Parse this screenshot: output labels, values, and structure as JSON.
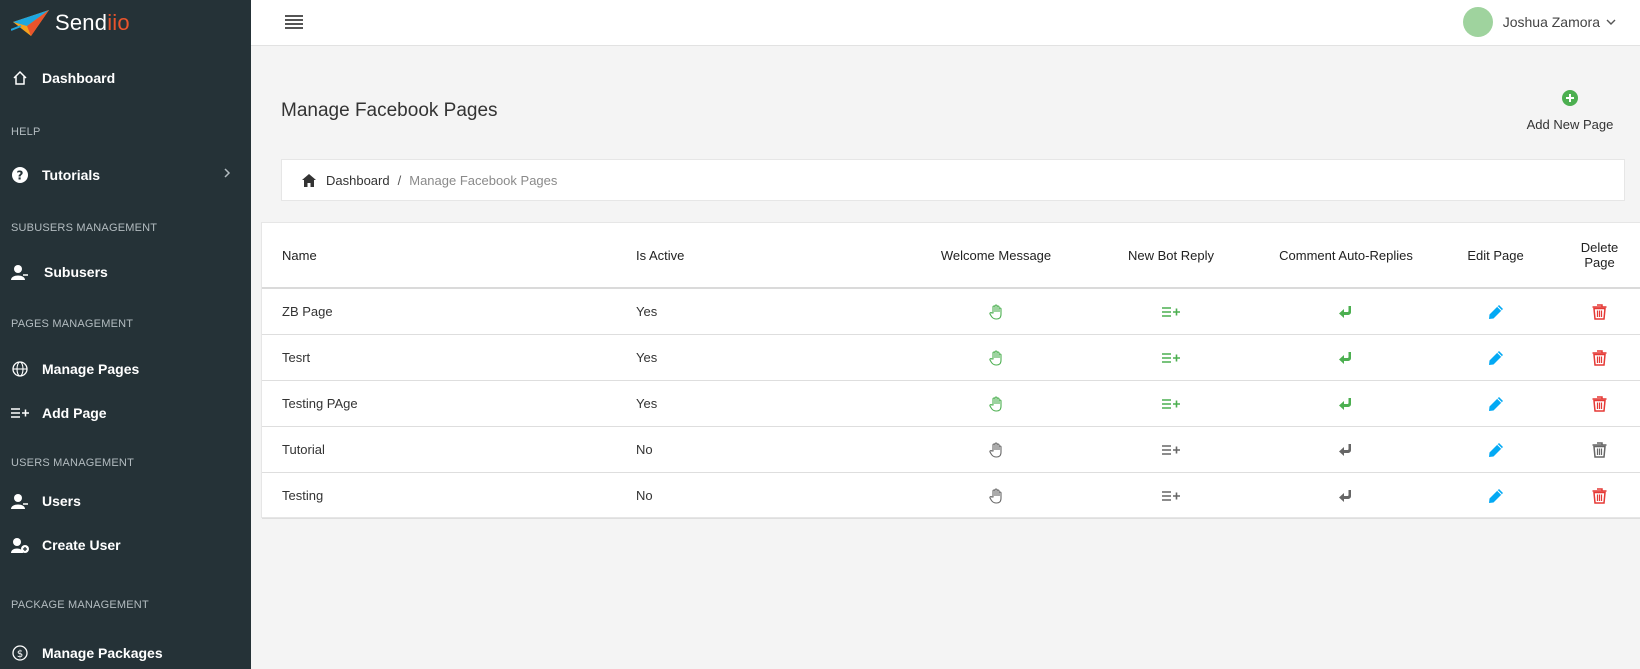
{
  "brand": {
    "name_main": "Send",
    "name_accent": "iio"
  },
  "sidebar": {
    "dashboard": "Dashboard",
    "help_heading": "HELP",
    "tutorials": "Tutorials",
    "subusers_heading": "SUBUSERS MANAGEMENT",
    "subusers": "Subusers",
    "pages_heading": "PAGES MANAGEMENT",
    "manage_pages": "Manage Pages",
    "add_page": "Add Page",
    "users_heading": "USERS MANAGEMENT",
    "users": "Users",
    "create_user": "Create User",
    "package_heading": "PACKAGE MANAGEMENT",
    "manage_packages": "Manage Packages"
  },
  "header": {
    "user_name": "Joshua Zamora"
  },
  "main": {
    "title": "Manage Facebook Pages",
    "add_new_label": "Add New Page",
    "breadcrumb": {
      "home": "Dashboard",
      "separator": "/",
      "current": "Manage Facebook Pages"
    }
  },
  "table": {
    "headers": {
      "name": "Name",
      "active": "Is Active",
      "welcome": "Welcome Message",
      "bot": "New Bot Reply",
      "comment": "Comment Auto-Replies",
      "edit": "Edit Page",
      "delete_line1": "Delete",
      "delete_line2": "Page"
    },
    "rows": [
      {
        "name": "ZB Page",
        "active": "Yes"
      },
      {
        "name": "Tesrt",
        "active": "Yes"
      },
      {
        "name": "Testing PAge",
        "active": "Yes"
      },
      {
        "name": "Tutorial",
        "active": "No"
      },
      {
        "name": "Testing",
        "active": "No"
      }
    ]
  },
  "colors": {
    "sidebar_bg": "#253237",
    "active_green": "#4caf50",
    "inactive_gray": "#666666",
    "edit_blue": "#03a9f4",
    "delete_red": "#e53935"
  },
  "icons": {
    "welcome": "hand-icon",
    "bot": "list-add-icon",
    "comment": "reply-icon",
    "edit": "pencil-icon",
    "delete": "trash-icon"
  }
}
